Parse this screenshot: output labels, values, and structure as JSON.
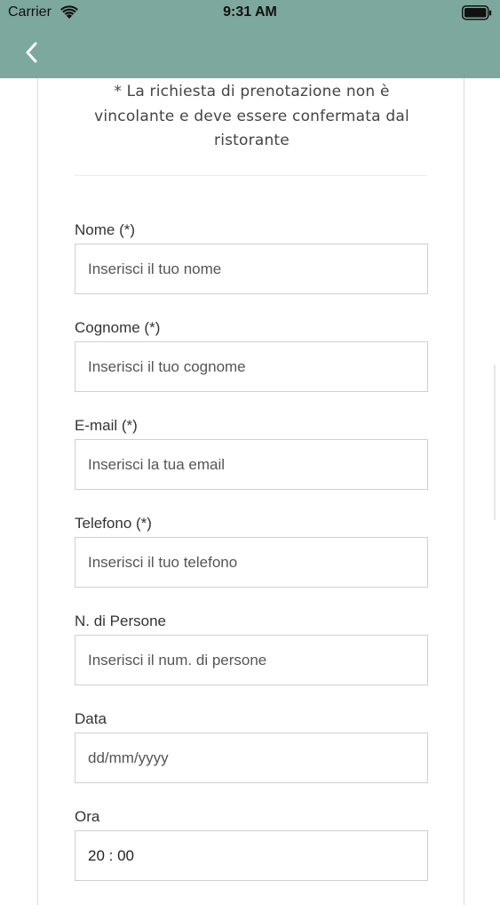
{
  "status_bar": {
    "carrier": "Carrier",
    "time": "9:31 AM"
  },
  "header": {
    "background_color": "#7da89d",
    "back_icon": "chevron-left-icon"
  },
  "notice": "* La richiesta di prenotazione non è vincolante e deve essere confermata dal ristorante",
  "fields": [
    {
      "label": "Nome (*)",
      "placeholder": "Inserisci il tuo nome",
      "value": ""
    },
    {
      "label": "Cognome (*)",
      "placeholder": "Inserisci il tuo cognome",
      "value": ""
    },
    {
      "label": "E-mail (*)",
      "placeholder": "Inserisci la tua email",
      "value": ""
    },
    {
      "label": "Telefono (*)",
      "placeholder": "Inserisci il tuo telefono",
      "value": ""
    },
    {
      "label": "N. di Persone",
      "placeholder": "Inserisci il num. di persone",
      "value": ""
    },
    {
      "label": "Data",
      "placeholder": "dd/mm/yyyy",
      "value": ""
    },
    {
      "label": "Ora",
      "placeholder": "",
      "value": "20 : 00"
    }
  ]
}
